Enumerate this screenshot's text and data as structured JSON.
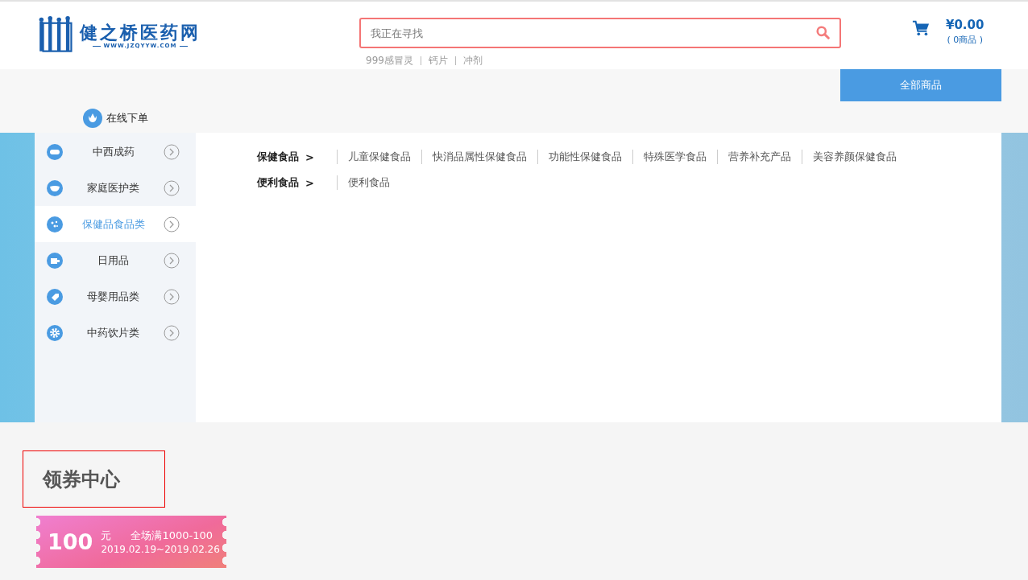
{
  "logo": {
    "name": "健之桥医药网",
    "url": "WWW.JZQYYW.COM"
  },
  "search": {
    "placeholder": "我正在寻找",
    "hot_words": [
      "999感冒灵",
      "钙片",
      "冲剂"
    ]
  },
  "cart": {
    "total": "¥0.00",
    "count": "( 0商品 )"
  },
  "all_products": "全部商品",
  "online_order": "在线下单",
  "categories": [
    {
      "name": "中西成药",
      "selected": false
    },
    {
      "name": "家庭医护类",
      "selected": false
    },
    {
      "name": "保健品食品类",
      "selected": true
    },
    {
      "name": "日用品",
      "selected": false
    },
    {
      "name": "母婴用品类",
      "selected": false
    },
    {
      "name": "中药饮片类",
      "selected": false
    }
  ],
  "subcategories": [
    {
      "title": "保健食品",
      "arrow": ">",
      "items": [
        "儿童保健食品",
        "快消品属性保健食品",
        "功能性保健食品",
        "特殊医学食品",
        "营养补充产品",
        "美容养颜保健食品"
      ]
    },
    {
      "title": "便利食品",
      "arrow": ">",
      "items": [
        "便利食品"
      ]
    }
  ],
  "coupon_section": {
    "title": "领券中心",
    "coupons": [
      {
        "amount": "100",
        "unit": "元",
        "condition": "全场满1000-100",
        "dates": "2019.02.19~2019.02.26"
      }
    ]
  }
}
